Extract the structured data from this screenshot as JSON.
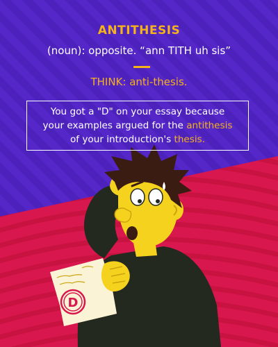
{
  "title": "ANTITHESIS",
  "definition": "(noun): opposite. “ann TITH uh sis”",
  "think": "THINK: anti-thesis.",
  "example": {
    "line1": "You got a \"D\" on your essay because",
    "line2": "your examples argued for the",
    "highlight1": "antithesis",
    "line3": "of your introduction's",
    "highlight2": "thesis."
  },
  "paper_grade": "D",
  "colors": {
    "purple": "#5527c9",
    "red": "#d8174e",
    "accent": "#f5b21b",
    "skin": "#f5d21e",
    "shirt": "#24291f",
    "hair": "#3b1c12"
  }
}
